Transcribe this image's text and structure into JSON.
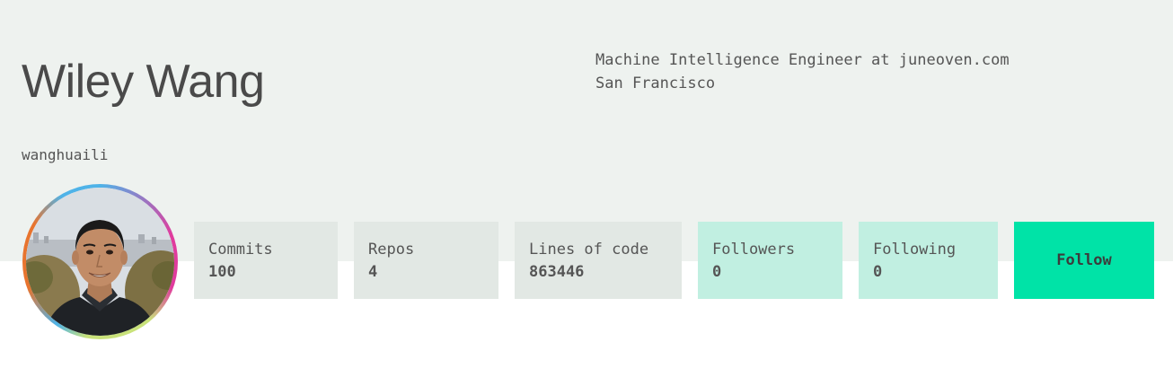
{
  "profile": {
    "name": "Wiley Wang",
    "username": "wanghuaili",
    "bio": {
      "title": "Machine Intelligence Engineer at juneoven.com",
      "location": "San Francisco"
    }
  },
  "stats": [
    {
      "label": "Commits",
      "value": "100"
    },
    {
      "label": "Repos",
      "value": "4"
    },
    {
      "label": "Lines of code",
      "value": "863446"
    },
    {
      "label": "Followers",
      "value": "0"
    },
    {
      "label": "Following",
      "value": "0"
    }
  ],
  "follow_button": {
    "label": "Follow"
  },
  "colors": {
    "header_bg": "#eef2ef",
    "stat_gray": "#e2e8e4",
    "stat_mint": "#c1efe1",
    "follow_accent": "#00e3a7"
  }
}
